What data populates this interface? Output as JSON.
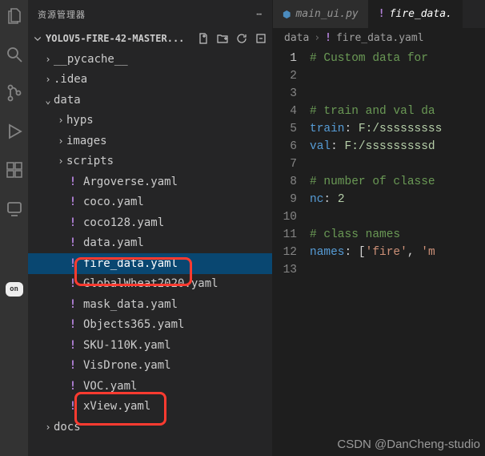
{
  "sidebar": {
    "title": "资源管理器",
    "root": "YOLOV5-FIRE-42-MASTER...",
    "chev_down": "⌄",
    "chev_right": "›",
    "yaml_icon": "!",
    "tree": {
      "pycache": "__pycache__",
      "idea": ".idea",
      "data": "data",
      "hyps": "hyps",
      "images": "images",
      "scripts": "scripts",
      "argoverse": "Argoverse.yaml",
      "coco": "coco.yaml",
      "coco128": "coco128.yaml",
      "datayaml": "data.yaml",
      "firedata": "fire_data.yaml",
      "globalwheat": "GlobalWheat2020.yaml",
      "maskdata": "mask_data.yaml",
      "objects365": "Objects365.yaml",
      "sku110k": "SKU-110K.yaml",
      "visdrone": "VisDrone.yaml",
      "voc": "VOC.yaml",
      "xview": "xView.yaml",
      "docs": "docs"
    }
  },
  "tabs": {
    "main": "main_ui.py",
    "fire": "fire_data."
  },
  "breadcrumb": {
    "p0": "data",
    "p1": "fire_data.yaml"
  },
  "code": {
    "l1": "# Custom data for ",
    "l4": "# train and val da",
    "l5k": "train",
    "l5v": " F:/sssssssss",
    "l6k": "val",
    "l6v": " F:/sssssssssd",
    "l8": "# number of classe",
    "l9k": "nc",
    "l9v": "2",
    "l11": "# class names",
    "l12k": "names",
    "l12b": "[",
    "l12s": "'fire'",
    "l12c": ", ",
    "l12s2": "'m"
  },
  "watermark": "CSDN @DanCheng-studio"
}
